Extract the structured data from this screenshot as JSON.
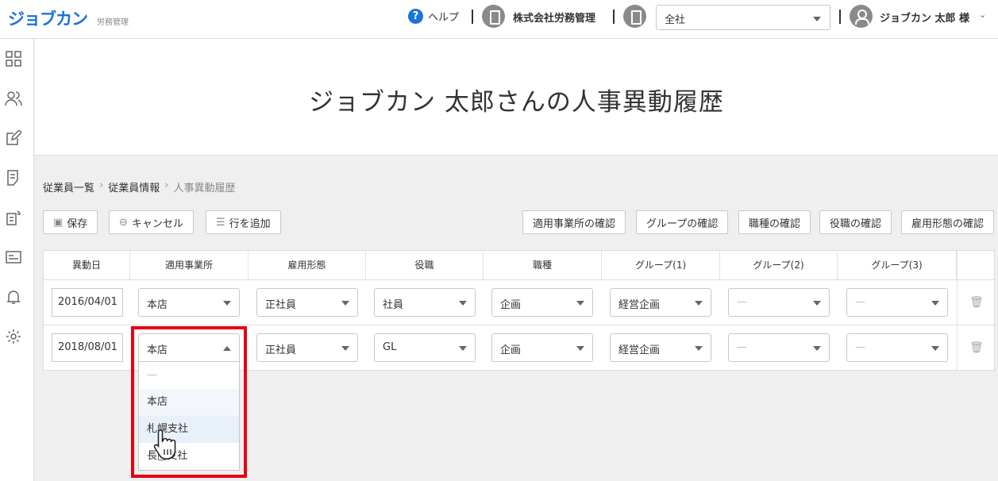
{
  "header": {
    "logo": "ジョブカン",
    "logo_sub": "労務管理",
    "help_label": "ヘルプ",
    "company_name": "株式会社労務管理",
    "scope_select": "全社",
    "user_name": "ジョブカン 太郎 様"
  },
  "sidebar": {
    "icons": [
      "dashboard-icon",
      "employees-icon",
      "edit-icon",
      "document-icon",
      "procedure-icon",
      "id-card-icon",
      "bell-icon",
      "gear-icon"
    ]
  },
  "page": {
    "title": "ジョブカン 太郎さんの人事異動履歴"
  },
  "breadcrumb": [
    "従業員一覧",
    "従業員情報",
    "人事異動履歴"
  ],
  "toolbar": {
    "save": "保存",
    "cancel": "キャンセル",
    "add_row": "行を追加",
    "check_office": "適用事業所の確認",
    "check_group": "グループの確認",
    "check_job_type": "職種の確認",
    "check_position": "役職の確認",
    "check_employment": "雇用形態の確認"
  },
  "table": {
    "headers": [
      "異動日",
      "適用事業所",
      "雇用形態",
      "役職",
      "職種",
      "グループ(1)",
      "グループ(2)",
      "グループ(3)"
    ],
    "rows": [
      {
        "date": "2016/04/01",
        "office": "本店",
        "employment": "正社員",
        "position": "社員",
        "job_type": "企画",
        "group1": "経営企画",
        "group2": "—",
        "group3": "—"
      },
      {
        "date": "2018/08/01",
        "office": "本店",
        "employment": "正社員",
        "position": "GL",
        "job_type": "企画",
        "group1": "経営企画",
        "group2": "—",
        "group3": "—"
      }
    ]
  },
  "office_dropdown": {
    "options": [
      "—",
      "本店",
      "札幌支社",
      "長□支社"
    ]
  }
}
